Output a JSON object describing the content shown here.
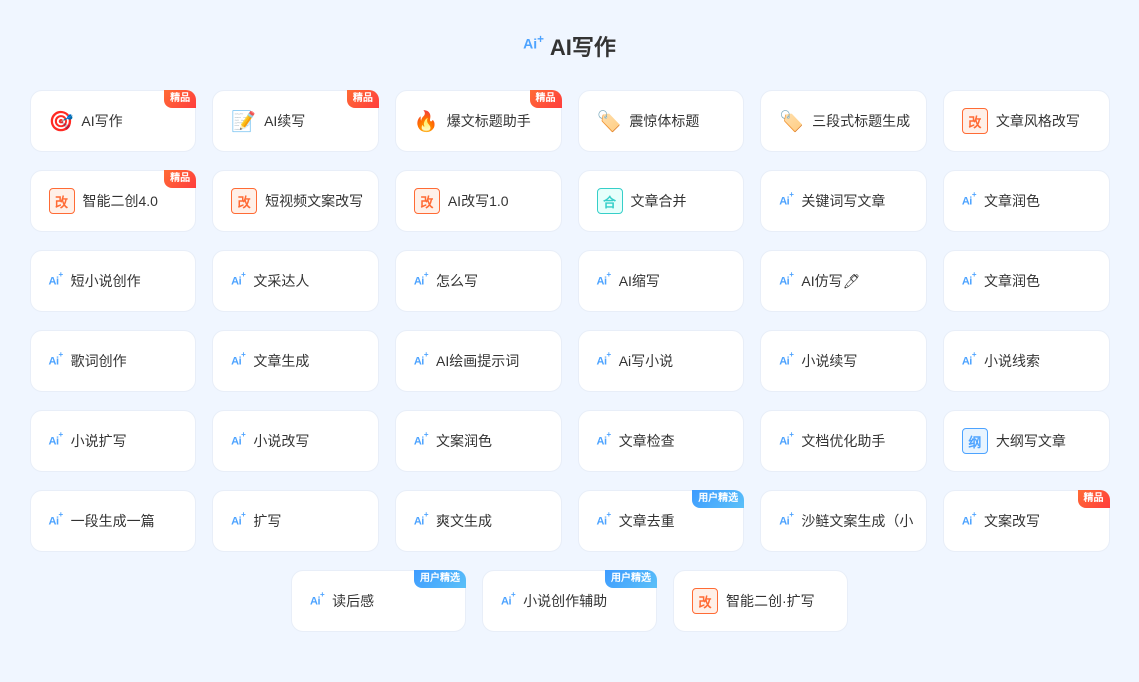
{
  "page": {
    "title": "AI写作",
    "title_prefix": "Ai"
  },
  "rows": [
    {
      "cards": [
        {
          "id": "ai-writing",
          "icon_type": "emoji",
          "icon": "🎯",
          "icon_color": "icon-orange",
          "prefix": "none",
          "label": "AI写作",
          "badge": "精品",
          "badge_type": "badge-jingpin"
        },
        {
          "id": "ai-continue",
          "icon_type": "emoji",
          "icon": "📝",
          "icon_color": "icon-blue",
          "prefix": "none",
          "label": "AI续写",
          "badge": "精品",
          "badge_type": "badge-jingpin"
        },
        {
          "id": "explode-title",
          "icon_type": "emoji",
          "icon": "🔥",
          "icon_color": "icon-red",
          "prefix": "none",
          "label": "爆文标题助手",
          "badge": "精品",
          "badge_type": "badge-jingpin"
        },
        {
          "id": "shocking-title",
          "icon_type": "emoji",
          "icon": "🏷️",
          "icon_color": "icon-pink",
          "prefix": "none",
          "label": "震惊体标题",
          "badge": "",
          "badge_type": ""
        },
        {
          "id": "three-title",
          "icon_type": "emoji",
          "icon": "🏷️",
          "icon_color": "icon-pink",
          "prefix": "none",
          "label": "三段式标题生成",
          "badge": "",
          "badge_type": ""
        },
        {
          "id": "article-style",
          "icon_type": "doc",
          "doc_class": "doc-orange",
          "doc_text": "改",
          "prefix": "none",
          "label": "文章风格改写",
          "badge": "",
          "badge_type": ""
        }
      ]
    },
    {
      "cards": [
        {
          "id": "smart-recreate",
          "icon_type": "doc",
          "doc_class": "doc-orange",
          "doc_text": "改",
          "prefix": "none",
          "label": "智能二创4.0",
          "badge": "精品",
          "badge_type": "badge-jingpin"
        },
        {
          "id": "short-video",
          "icon_type": "doc",
          "doc_class": "doc-orange",
          "doc_text": "改",
          "prefix": "none",
          "label": "短视频文案改写",
          "badge": "",
          "badge_type": ""
        },
        {
          "id": "ai-rewrite",
          "icon_type": "doc",
          "doc_class": "doc-orange",
          "doc_text": "改",
          "prefix": "none",
          "label": "AI改写1.0",
          "badge": "",
          "badge_type": ""
        },
        {
          "id": "article-merge",
          "icon_type": "doc",
          "doc_class": "doc-teal",
          "doc_text": "合",
          "prefix": "none",
          "label": "文章合并",
          "badge": "",
          "badge_type": ""
        },
        {
          "id": "keyword-write",
          "icon_type": "ai",
          "prefix": "Ai+",
          "label": "关键词写文章",
          "badge": "",
          "badge_type": ""
        },
        {
          "id": "article-polish1",
          "icon_type": "ai",
          "prefix": "Ai+",
          "label": "文章润色",
          "badge": "",
          "badge_type": ""
        }
      ]
    },
    {
      "cards": [
        {
          "id": "short-novel",
          "icon_type": "ai",
          "prefix": "Ai+",
          "label": "短小说创作",
          "badge": "",
          "badge_type": ""
        },
        {
          "id": "writing-talent",
          "icon_type": "ai",
          "prefix": "Ai+",
          "label": "文采达人",
          "badge": "",
          "badge_type": ""
        },
        {
          "id": "how-to-write",
          "icon_type": "ai",
          "prefix": "Ai+",
          "label": "怎么写",
          "badge": "",
          "badge_type": ""
        },
        {
          "id": "ai-summarize",
          "icon_type": "ai",
          "prefix": "Ai+",
          "label": "AI缩写",
          "badge": "",
          "badge_type": ""
        },
        {
          "id": "ai-imitate",
          "icon_type": "ai",
          "prefix": "Ai+",
          "label": "AI仿写🖊",
          "badge": "",
          "badge_type": ""
        },
        {
          "id": "article-polish2",
          "icon_type": "ai",
          "prefix": "Ai+",
          "label": "文章润色",
          "badge": "",
          "badge_type": ""
        }
      ]
    },
    {
      "cards": [
        {
          "id": "lyrics-create",
          "icon_type": "ai",
          "prefix": "Ai+",
          "label": "歌词创作",
          "badge": "",
          "badge_type": ""
        },
        {
          "id": "article-generate",
          "icon_type": "ai",
          "prefix": "Ai+",
          "label": "文章生成",
          "badge": "",
          "badge_type": ""
        },
        {
          "id": "ai-draw-prompt",
          "icon_type": "ai",
          "prefix": "Ai+",
          "label": "AI绘画提示词",
          "badge": "",
          "badge_type": ""
        },
        {
          "id": "ai-write-novel",
          "icon_type": "ai",
          "prefix": "Ai+",
          "label": "Ai写小说",
          "badge": "",
          "badge_type": ""
        },
        {
          "id": "novel-continue",
          "icon_type": "ai",
          "prefix": "Ai+",
          "label": "小说续写",
          "badge": "",
          "badge_type": ""
        },
        {
          "id": "novel-clue",
          "icon_type": "ai",
          "prefix": "Ai+",
          "label": "小说线索",
          "badge": "",
          "badge_type": ""
        }
      ]
    },
    {
      "cards": [
        {
          "id": "novel-expand",
          "icon_type": "ai",
          "prefix": "Ai+",
          "label": "小说扩写",
          "badge": "",
          "badge_type": ""
        },
        {
          "id": "novel-rewrite",
          "icon_type": "ai",
          "prefix": "Ai+",
          "label": "小说改写",
          "badge": "",
          "badge_type": ""
        },
        {
          "id": "copy-polish",
          "icon_type": "ai",
          "prefix": "Ai+",
          "label": "文案润色",
          "badge": "",
          "badge_type": ""
        },
        {
          "id": "article-check",
          "icon_type": "ai",
          "prefix": "Ai+",
          "label": "文章检查",
          "badge": "",
          "badge_type": ""
        },
        {
          "id": "doc-optimize",
          "icon_type": "ai",
          "prefix": "Ai+",
          "label": "文档优化助手",
          "badge": "",
          "badge_type": ""
        },
        {
          "id": "outline-write",
          "icon_type": "doc",
          "doc_class": "doc-blue",
          "doc_text": "纲",
          "prefix": "none",
          "label": "大纲写文章",
          "badge": "",
          "badge_type": ""
        }
      ]
    },
    {
      "cards": [
        {
          "id": "one-para-gen",
          "icon_type": "ai",
          "prefix": "Ai+",
          "label": "一段生成一篇",
          "badge": "",
          "badge_type": ""
        },
        {
          "id": "expand-write",
          "icon_type": "ai",
          "prefix": "Ai+",
          "label": "扩写",
          "badge": "",
          "badge_type": ""
        },
        {
          "id": "爽文-generate",
          "icon_type": "ai",
          "prefix": "Ai+",
          "label": "爽文生成",
          "badge": "",
          "badge_type": ""
        },
        {
          "id": "article-dedup",
          "icon_type": "ai",
          "prefix": "Ai+",
          "label": "文章去重",
          "badge": "用户精选",
          "badge_type": "badge-yonghu"
        },
        {
          "id": "shalei-copy",
          "icon_type": "ai",
          "prefix": "Ai+",
          "label": "沙鲢文案生成（小",
          "badge": "",
          "badge_type": ""
        },
        {
          "id": "copy-rewrite",
          "icon_type": "ai",
          "prefix": "Ai+",
          "label": "文案改写",
          "badge": "精品",
          "badge_type": "badge-jingpin"
        }
      ]
    },
    {
      "centered": true,
      "cards": [
        {
          "id": "read-review",
          "icon_type": "ai",
          "prefix": "Ai+",
          "label": "读后感",
          "badge": "用户精选",
          "badge_type": "badge-yonghu"
        },
        {
          "id": "novel-assist",
          "icon_type": "ai",
          "prefix": "Ai+",
          "label": "小说创作辅助",
          "badge": "用户精选",
          "badge_type": "badge-yonghu"
        },
        {
          "id": "smart-recreate2",
          "icon_type": "doc",
          "doc_class": "doc-orange",
          "doc_text": "改",
          "prefix": "none",
          "label": "智能二创·扩写",
          "badge": "",
          "badge_type": ""
        }
      ]
    }
  ]
}
